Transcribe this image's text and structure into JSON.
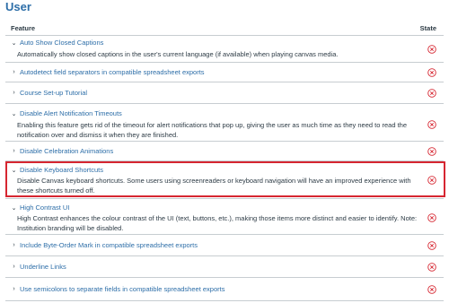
{
  "section": {
    "title": "User"
  },
  "table": {
    "col_feature": "Feature",
    "col_state": "State"
  },
  "features": [
    {
      "title": "Auto Show Closed Captions",
      "expanded": true,
      "description": "Automatically show closed captions in the user's current language (if available) when playing canvas media.",
      "state": "disabled"
    },
    {
      "title": "Autodetect field separators in compatible spreadsheet exports",
      "expanded": false,
      "description": "",
      "state": "disabled"
    },
    {
      "title": "Course Set-up Tutorial",
      "expanded": false,
      "description": "",
      "state": "disabled"
    },
    {
      "title": "Disable Alert Notification Timeouts",
      "expanded": true,
      "description": "Enabling this feature gets rid of the timeout for alert notifications that pop up, giving the user as much time as they need to read the notification over and dismiss it when they are finished.",
      "state": "disabled"
    },
    {
      "title": "Disable Celebration Animations",
      "expanded": false,
      "description": "",
      "state": "disabled"
    },
    {
      "title": "Disable Keyboard Shortcuts",
      "expanded": true,
      "description": "Disable Canvas keyboard shortcuts. Some users using screenreaders or keyboard navigation will have an improved experience with these shortcuts turned off.",
      "state": "disabled"
    },
    {
      "title": "High Contrast UI",
      "expanded": true,
      "description": "High Contrast enhances the colour contrast of the UI (text, buttons, etc.), making those items more distinct and easier to identify. Note: Institution branding will be disabled.",
      "state": "disabled"
    },
    {
      "title": "Include Byte-Order Mark in compatible spreadsheet exports",
      "expanded": false,
      "description": "",
      "state": "disabled"
    },
    {
      "title": "Underline Links",
      "expanded": false,
      "description": "",
      "state": "disabled"
    },
    {
      "title": "Use semicolons to separate fields in compatible spreadsheet exports",
      "expanded": false,
      "description": "",
      "state": "disabled"
    }
  ],
  "colors": {
    "link": "#2d6ea8",
    "disabled_icon": "#d62631",
    "highlight": "#d62631"
  }
}
